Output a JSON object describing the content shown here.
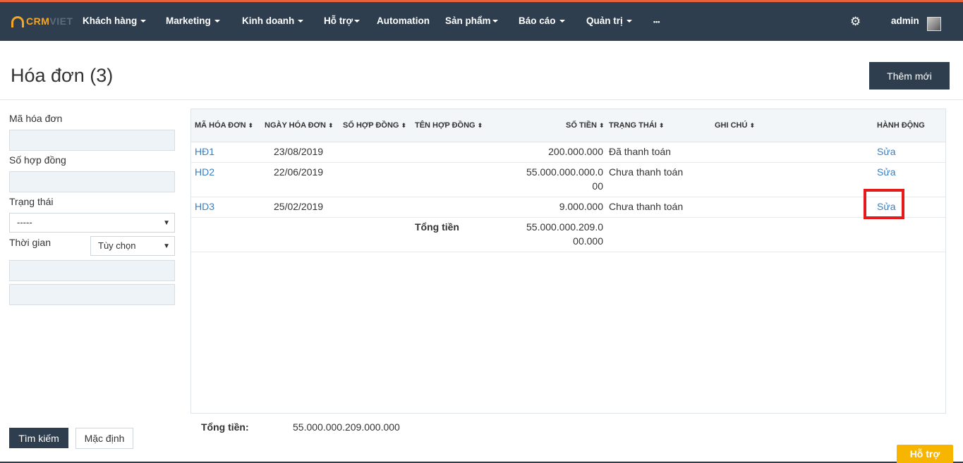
{
  "brand": {
    "logo_crm": "CRM",
    "logo_viet": "VIET"
  },
  "nav": {
    "items": [
      {
        "label": "Khách hàng",
        "dropdown": true
      },
      {
        "label": "Marketing",
        "dropdown": true
      },
      {
        "label": "Kinh doanh",
        "dropdown": true
      },
      {
        "label": "Hỗ trợ",
        "dropdown": true
      },
      {
        "label": "Automation",
        "dropdown": false
      },
      {
        "label": "Sản phẩm",
        "dropdown": true
      },
      {
        "label": "Báo cáo",
        "dropdown": true
      },
      {
        "label": "Quản trị",
        "dropdown": true
      },
      {
        "label": "•••",
        "dropdown": false
      }
    ],
    "user": "admin"
  },
  "page": {
    "title": "Hóa đơn (3)",
    "add_button": "Thêm mới"
  },
  "filters": {
    "invoice_code_label": "Mã hóa đơn",
    "contract_no_label": "Số hợp đồng",
    "status_label": "Trạng thái",
    "status_value": "-----",
    "time_label": "Thời gian",
    "time_option": "Tùy chọn",
    "search_button": "Tìm kiếm",
    "default_button": "Mặc định"
  },
  "table": {
    "headers": {
      "code": "MÃ HÓA ĐƠN",
      "date": "NGÀY HÓA ĐƠN",
      "contract_no": "SỐ HỢP ĐỒNG",
      "contract_name": "TÊN HỢP ĐỒNG",
      "amount": "SỐ TIỀN",
      "status": "TRẠNG THÁI",
      "note": "GHI CHÚ",
      "action": "HÀNH ĐỘNG"
    },
    "rows": [
      {
        "code": "HĐ1",
        "date": "23/08/2019",
        "amount": "200.000.000",
        "status": "Đã thanh toán",
        "action": "Sửa"
      },
      {
        "code": "HD2",
        "date": "22/06/2019",
        "amount": "55.000.000.000.000",
        "status": "Chưa thanh toán",
        "action": "Sửa"
      },
      {
        "code": "HD3",
        "date": "25/02/2019",
        "amount": "9.000.000",
        "status": "Chưa thanh toán",
        "action": "Sửa"
      }
    ],
    "total_label": "Tổng tiền",
    "total_value": "55.000.000.209.000.000"
  },
  "summary": {
    "label": "Tổng tiền:",
    "value": "55.000.000.209.000.000"
  },
  "help_button": "Hỗ trợ"
}
